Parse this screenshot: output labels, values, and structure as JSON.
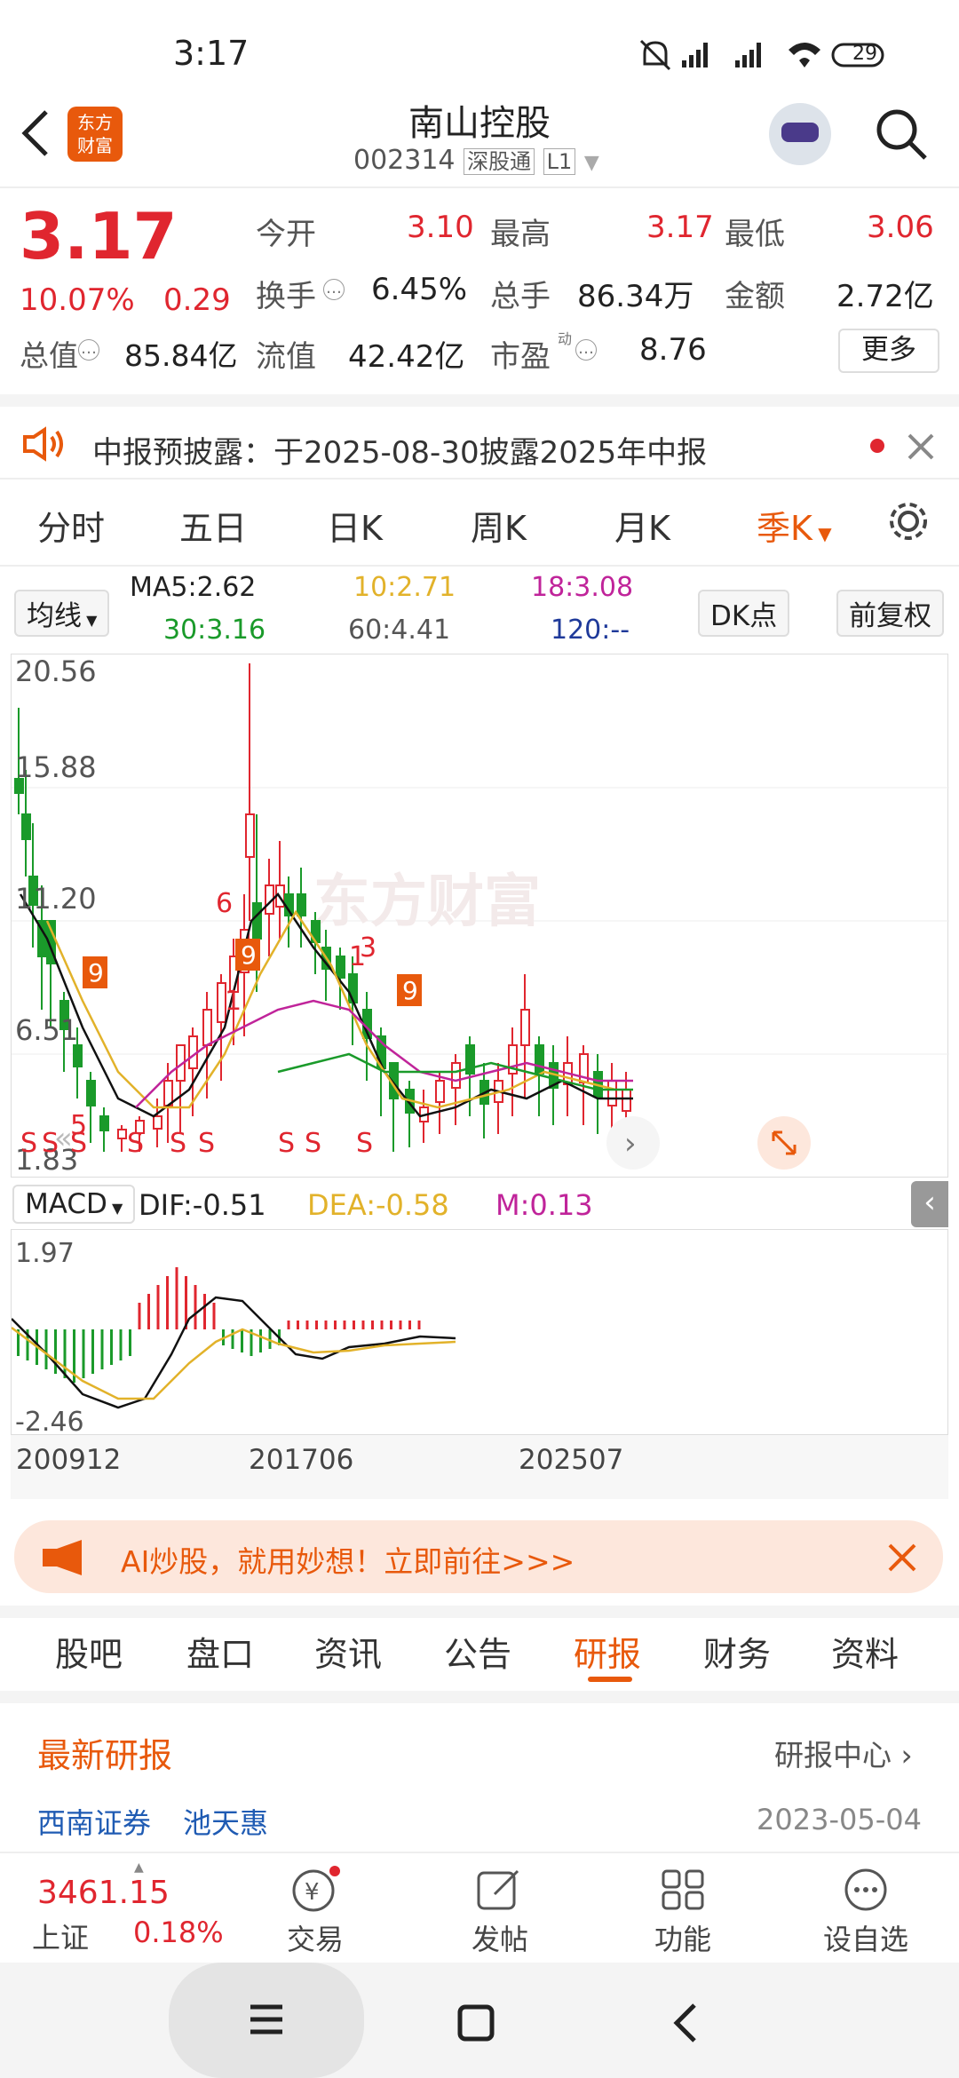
{
  "status": {
    "time": "3:17",
    "battery": "29"
  },
  "header": {
    "title": "南山控股",
    "code": "002314",
    "badge1": "深股通",
    "badge2": "L1",
    "logo_text": "东方\n财富"
  },
  "quote": {
    "price": "3.17",
    "pct": "10.07%",
    "chg": "0.29",
    "open_l": "今开",
    "open": "3.10",
    "high_l": "最高",
    "high": "3.17",
    "low_l": "最低",
    "low": "3.06",
    "turn_l": "换手",
    "turn": "6.45%",
    "vol_l": "总手",
    "vol": "86.34万",
    "amt_l": "金额",
    "amt": "2.72亿",
    "mcap_l": "总值",
    "mcap": "85.84亿",
    "float_l": "流值",
    "float": "42.42亿",
    "pe_l": "市盈",
    "pe_sup": "动",
    "pe": "8.76",
    "more": "更多"
  },
  "notice": {
    "text": "中报预披露：于2025-08-30披露2025年中报"
  },
  "tabs": [
    "分时",
    "五日",
    "日K",
    "周K",
    "月K",
    "季K"
  ],
  "ma": {
    "sel": "均线",
    "ma5": "MA5:2.62",
    "ma10": "10:2.71",
    "ma18": "18:3.08",
    "ma30": "30:3.16",
    "ma60": "60:4.41",
    "ma120": "120:--",
    "dk": "DK点",
    "fq": "前复权"
  },
  "chart_data": {
    "type": "candlestick",
    "ylabels": [
      "20.56",
      "15.88",
      "11.20",
      "6.51",
      "1.83"
    ],
    "watermark": "东方财富",
    "macd": {
      "label": "MACD",
      "dif": "DIF:-0.51",
      "dea": "DEA:-0.58",
      "m": "M:0.13",
      "ylabels": [
        "1.97",
        "-2.46"
      ]
    },
    "xlabels": [
      "200912",
      "201706",
      "202507"
    ]
  },
  "ad": {
    "text": "AI炒股，就用妙想！立即前往>>>"
  },
  "bottom_tabs": [
    "股吧",
    "盘口",
    "资讯",
    "公告",
    "研报",
    "财务",
    "资料"
  ],
  "report": {
    "title": "最新研报",
    "center": "研报中心",
    "broker": "西南证券",
    "analyst": "池天惠",
    "date": "2023-05-04"
  },
  "nav": {
    "index_val": "3461.15",
    "index_name": "上证",
    "index_pct": "0.18%",
    "trade": "交易",
    "post": "发帖",
    "func": "功能",
    "watch": "设自选"
  },
  "colors": {
    "up": "#e0262f",
    "down": "#1a9a2a",
    "accent": "#e8590c"
  }
}
